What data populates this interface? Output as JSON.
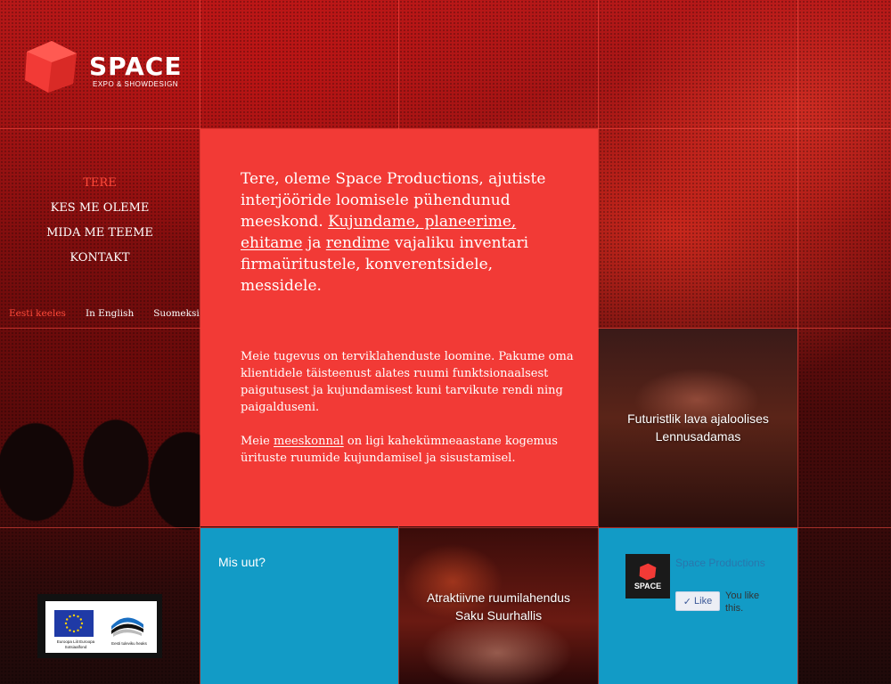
{
  "brand": {
    "name": "SPACE",
    "tagline": "EXPO & SHOWDESIGN"
  },
  "nav": {
    "items": [
      {
        "label": "TERE",
        "active": true
      },
      {
        "label": "KES ME OLEME",
        "active": false
      },
      {
        "label": "MIDA ME TEEME",
        "active": false
      },
      {
        "label": "KONTAKT",
        "active": false
      }
    ]
  },
  "languages": [
    {
      "label": "Eesti keeles",
      "active": true
    },
    {
      "label": "In English",
      "active": false
    },
    {
      "label": "Suomeksi",
      "active": false
    }
  ],
  "intro": {
    "part1": "Tere, oleme Space Productions, ajutiste interjööride loomisele pühendunud meeskond.",
    "link1": "Kujundame, planeerime, ehitame",
    "mid": "ja",
    "link2": "rendime",
    "part2": "vajaliku inventari firmaüritustele, konverentsidele, messidele."
  },
  "body": {
    "p1": "Meie tugevus on terviklahenduste loomine. Pakume oma klientidele täisteenust alates ruumi funktsionaalsest paigutusest ja kujundamisest kuni tarvikute rendi ning paigalduseni.",
    "p2_pre": "Meie",
    "p2_link": "meeskonnal",
    "p2_post": "on ligi kahekümneaastane kogemus ürituste ruumide kujundamisel ja sisustamisel."
  },
  "tiles": {
    "project1": "Futuristlik lava ajaloolises Lennusadamas",
    "project2": "Atraktiivne ruumilahendus Saku Suurhallis",
    "news": "Mis uut?"
  },
  "facebook": {
    "page_name": "Space Productions",
    "logo_word": "SPACE",
    "like_label": "Like",
    "you_like": "You like this."
  },
  "eu": {
    "left_caption": "Euroopa Liit Euroopa Sotsiaalfond",
    "right_caption": "Eesti tuleviku heaks"
  },
  "colors": {
    "accent": "#f23a36",
    "blue": "#129bc6",
    "active_link": "#ff4a3a"
  }
}
